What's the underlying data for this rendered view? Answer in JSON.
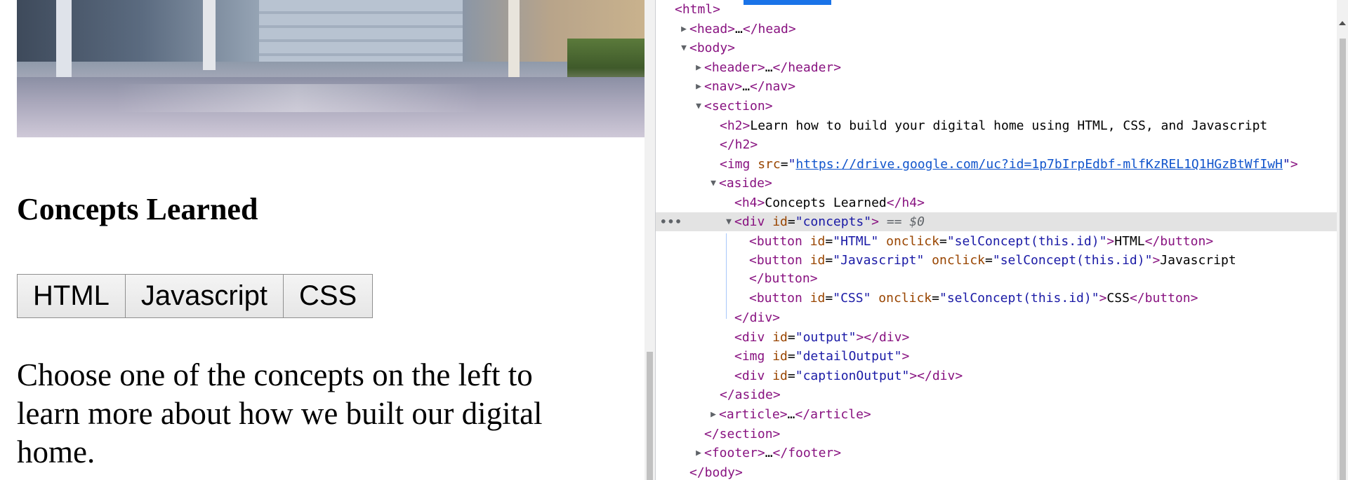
{
  "page": {
    "heading": "Concepts Learned",
    "buttons": [
      "HTML",
      "Javascript",
      "CSS"
    ],
    "instructions": "Choose one of the concepts on the left to learn more about how we built our digital home."
  },
  "devtools": {
    "lines": {
      "html": "<html>",
      "head_open": "<head>",
      "head_ellipsis": "…",
      "head_close": "</head>",
      "body": "<body>",
      "header_open": "<header>",
      "header_ellipsis": "…",
      "header_close": "</header>",
      "nav_open": "<nav>",
      "nav_ellipsis": "…",
      "nav_close": "</nav>",
      "section": "<section>",
      "h2_open": "<h2>",
      "h2_text": "Learn how to build your digital home using HTML, CSS, and Javascript",
      "h2_close": "</h2>",
      "img_tag": "<img",
      "img_attr": "src",
      "img_url": "https://drive.google.com/uc?id=1p7bIrpEdbf-mlfKzREL1Q1HGzBtWfIwH",
      "img_end": ">",
      "aside": "<aside>",
      "h4_open": "<h4>",
      "h4_text": "Concepts Learned",
      "h4_close": "</h4>",
      "div_open": "<div",
      "div_attr": "id",
      "div_val": "concepts",
      "div_end": ">",
      "selected_marker": "== $0",
      "btn_open": "<button",
      "btn_id": "id",
      "btn_onclick": "onclick",
      "btn_handler": "selConcept(this.id)",
      "btn_end": ">",
      "btn_close": "</button>",
      "btn1_id": "HTML",
      "btn1_text": "HTML",
      "btn2_id": "Javascript",
      "btn2_text": "Javascript",
      "btn3_id": "CSS",
      "btn3_text": "CSS",
      "div_close": "</div>",
      "output_div": "<div",
      "output_id": "output",
      "output_close": "></div>",
      "img2_tag": "<img",
      "img2_id": "detailOutput",
      "caption_div": "<div",
      "caption_id": "captionOutput",
      "aside_close": "</aside>",
      "article_open": "<article>",
      "article_ellipsis": "…",
      "article_close": "</article>",
      "section_close": "</section>",
      "footer_open": "<footer>",
      "footer_ellipsis": "…",
      "footer_close": "</footer>",
      "body_close": "</body>"
    },
    "dots": "•••"
  }
}
